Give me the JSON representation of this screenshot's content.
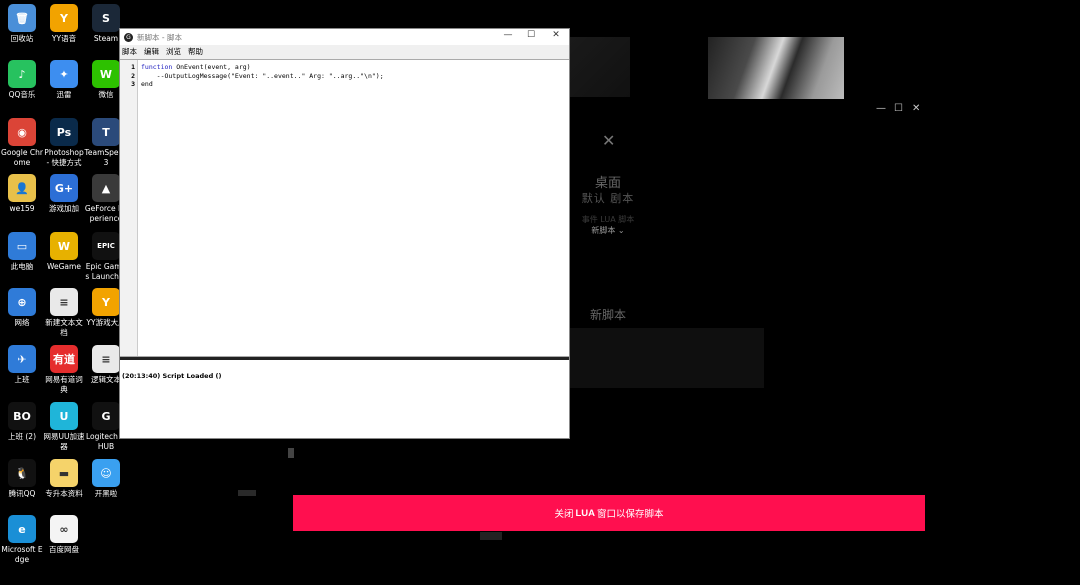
{
  "desktop": {
    "icons": [
      {
        "label": "回收站",
        "icon": "recycle-bin-icon",
        "color": "#4a8fd8",
        "glyph": "🗑"
      },
      {
        "label": "YY语音",
        "icon": "yy-voice-icon",
        "color": "#f2a300",
        "glyph": "Y"
      },
      {
        "label": "Steam",
        "icon": "steam-icon",
        "color": "#1b2838",
        "glyph": "S"
      },
      {
        "label": "QQ音乐",
        "icon": "qq-music-icon",
        "color": "#27c25f",
        "glyph": "♪"
      },
      {
        "label": "迅雷",
        "icon": "xunlei-icon",
        "color": "#3d8ef0",
        "glyph": "✦"
      },
      {
        "label": "微信",
        "icon": "wechat-icon",
        "color": "#2dc100",
        "glyph": "W"
      },
      {
        "label": "Google Chrome",
        "icon": "chrome-icon",
        "color": "#db4437",
        "glyph": "◉"
      },
      {
        "label": "Photoshop - 快捷方式",
        "icon": "photoshop-icon",
        "color": "#0a2a4a",
        "glyph": "Ps"
      },
      {
        "label": "TeamSpeak 3",
        "icon": "teamspeak-icon",
        "color": "#2b4a7a",
        "glyph": "T"
      },
      {
        "label": "we159",
        "icon": "user-folder-icon",
        "color": "#e8c04a",
        "glyph": "👤"
      },
      {
        "label": "游戏加加",
        "icon": "youxijiajia-icon",
        "color": "#2c6fd6",
        "glyph": "G+"
      },
      {
        "label": "GeForce Experience",
        "icon": "geforce-icon",
        "color": "#3a3a3a",
        "glyph": "▲"
      },
      {
        "label": "此电脑",
        "icon": "this-pc-icon",
        "color": "#2f7bd8",
        "glyph": "▭"
      },
      {
        "label": "WeGame",
        "icon": "wegame-icon",
        "color": "#e7b100",
        "glyph": "W"
      },
      {
        "label": "Epic Games Launcher",
        "icon": "epic-games-icon",
        "color": "#111111",
        "glyph": "EPIC"
      },
      {
        "label": "网络",
        "icon": "network-icon",
        "color": "#2f7bd8",
        "glyph": "⊕"
      },
      {
        "label": "新建文本文档",
        "icon": "text-file-icon",
        "color": "#e9e9e9",
        "glyph": "≡"
      },
      {
        "label": "YY游戏大厅",
        "icon": "yy-game-icon",
        "color": "#f2a300",
        "glyph": "Y"
      },
      {
        "label": "上班",
        "icon": "shortcut-app-icon",
        "color": "#2f7bd8",
        "glyph": "✈"
      },
      {
        "label": "网易有道词典",
        "icon": "youdao-icon",
        "color": "#e52d2d",
        "glyph": "有道"
      },
      {
        "label": "逻辑文本",
        "icon": "text-file-icon",
        "color": "#e9e9e9",
        "glyph": "≡"
      },
      {
        "label": "上班 (2)",
        "icon": "black-ops-icon",
        "color": "#111111",
        "glyph": "BO"
      },
      {
        "label": "网易UU加速器",
        "icon": "uu-accelerator-icon",
        "color": "#1fb5d9",
        "glyph": "U"
      },
      {
        "label": "Logitech G HUB",
        "icon": "logitech-icon",
        "color": "#111111",
        "glyph": "G"
      },
      {
        "label": "腾讯QQ",
        "icon": "qq-icon",
        "color": "#111111",
        "glyph": "🐧"
      },
      {
        "label": "专升本资料",
        "icon": "folder-icon",
        "color": "#f5d36a",
        "glyph": "▬"
      },
      {
        "label": "开黑啦",
        "icon": "kaiheila-icon",
        "color": "#3aa0f0",
        "glyph": "☺"
      },
      {
        "label": "Microsoft Edge",
        "icon": "edge-icon",
        "color": "#1a8fd6",
        "glyph": "e"
      },
      {
        "label": "百度网盘",
        "icon": "baidu-netdisk-icon",
        "color": "#f4f4f4",
        "glyph": "∞"
      }
    ]
  },
  "editor": {
    "title": "新脚本 - 脚本",
    "window_controls": {
      "minimize": "—",
      "maximize": "☐",
      "close": "✕"
    },
    "menu": [
      "脚本",
      "编辑",
      "浏览",
      "帮助"
    ],
    "gutter": [
      "1",
      "2",
      "3"
    ],
    "code": {
      "line1_kw": "function",
      "line1_rest": " OnEvent(event, arg)",
      "line2": "    --OutputLogMessage(\"Event: \"..event..\" Arg: \"..arg..\"\\n\");",
      "line3": "end"
    },
    "output": "(20:13:40) Script Loaded ()"
  },
  "background_app": {
    "window_controls": {
      "minimize": "—",
      "maximize": "☐",
      "close": "✕"
    },
    "close_x": "✕",
    "title": "桌面",
    "subtitle": "默认 剧本",
    "lua_label": "事件 LUA 脚本",
    "dropdown_value": "新脚本",
    "dropdown_arrow": "⌄",
    "script_name": "新脚本",
    "close_button": {
      "prefix": "关闭",
      "bold": "LUA",
      "suffix": "窗口以保存脚本"
    },
    "accent": "#ff0f4f"
  }
}
